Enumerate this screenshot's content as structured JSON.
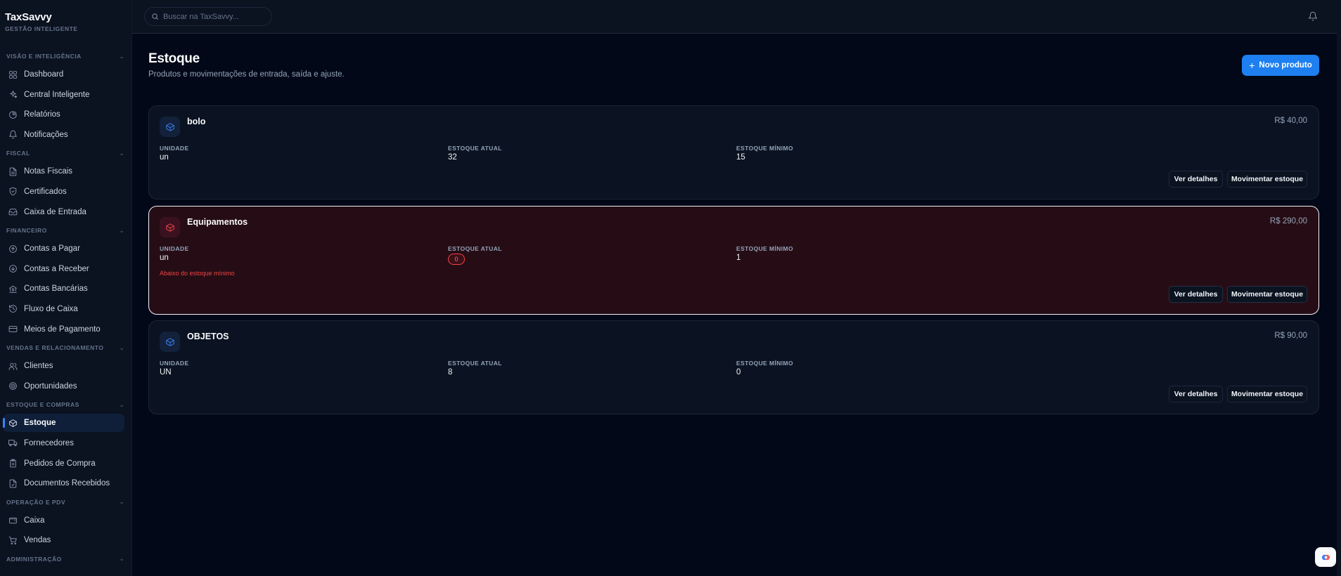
{
  "brand": {
    "name": "TaxSavvy",
    "tagline": "GESTÃO INTELIGENTE"
  },
  "search": {
    "placeholder": "Buscar na TaxSavvy..."
  },
  "sidebar": {
    "sections": [
      {
        "title": "VISÃO E INTELIGÊNCIA",
        "items": [
          {
            "label": "Dashboard",
            "icon": "grid-icon"
          },
          {
            "label": "Central Inteligente",
            "icon": "sparkles-icon"
          },
          {
            "label": "Relatórios",
            "icon": "pie-chart-icon"
          },
          {
            "label": "Notificações",
            "icon": "bell-icon"
          }
        ]
      },
      {
        "title": "FISCAL",
        "items": [
          {
            "label": "Notas Fiscais",
            "icon": "file-text-icon"
          },
          {
            "label": "Certificados",
            "icon": "shield-icon"
          },
          {
            "label": "Caixa de Entrada",
            "icon": "inbox-icon"
          }
        ]
      },
      {
        "title": "FINANCEIRO",
        "items": [
          {
            "label": "Contas a Pagar",
            "icon": "arrow-up-circle-icon"
          },
          {
            "label": "Contas a Receber",
            "icon": "arrow-down-circle-icon"
          },
          {
            "label": "Contas Bancárias",
            "icon": "bank-icon"
          },
          {
            "label": "Fluxo de Caixa",
            "icon": "history-icon"
          },
          {
            "label": "Meios de Pagamento",
            "icon": "credit-card-icon"
          }
        ]
      },
      {
        "title": "VENDAS E RELACIONAMENTO",
        "items": [
          {
            "label": "Clientes",
            "icon": "users-icon"
          },
          {
            "label": "Oportunidades",
            "icon": "target-icon"
          }
        ]
      },
      {
        "title": "ESTOQUE E COMPRAS",
        "items": [
          {
            "label": "Estoque",
            "icon": "package-icon",
            "active": true
          },
          {
            "label": "Fornecedores",
            "icon": "truck-icon"
          },
          {
            "label": "Pedidos de Compra",
            "icon": "clipboard-icon"
          },
          {
            "label": "Documentos Recebidos",
            "icon": "file-check-icon"
          }
        ]
      },
      {
        "title": "OPERAÇÃO E PDV",
        "items": [
          {
            "label": "Caixa",
            "icon": "wallet-icon"
          },
          {
            "label": "Vendas",
            "icon": "cart-icon"
          }
        ]
      },
      {
        "title": "ADMINISTRAÇÃO",
        "items": []
      }
    ]
  },
  "page": {
    "title": "Estoque",
    "subtitle": "Produtos e movimentações de entrada, saída e ajuste.",
    "new_button": "Novo produto"
  },
  "labels": {
    "unit": "UNIDADE",
    "current": "ESTOQUE ATUAL",
    "minimum": "ESTOQUE MÍNIMO",
    "details": "Ver detalhes",
    "move": "Movimentar estoque",
    "below_min": "Abaixo do estoque mínimo"
  },
  "products": [
    {
      "name": "bolo",
      "price": "R$ 40,00",
      "unit": "un",
      "current": "32",
      "minimum": "15",
      "alert": false
    },
    {
      "name": "Equipamentos",
      "price": "R$ 290,00",
      "unit": "un",
      "current": "0",
      "minimum": "1",
      "alert": true
    },
    {
      "name": "OBJETOS",
      "price": "R$ 90,00",
      "unit": "UN",
      "current": "8",
      "minimum": "0",
      "alert": false
    }
  ]
}
